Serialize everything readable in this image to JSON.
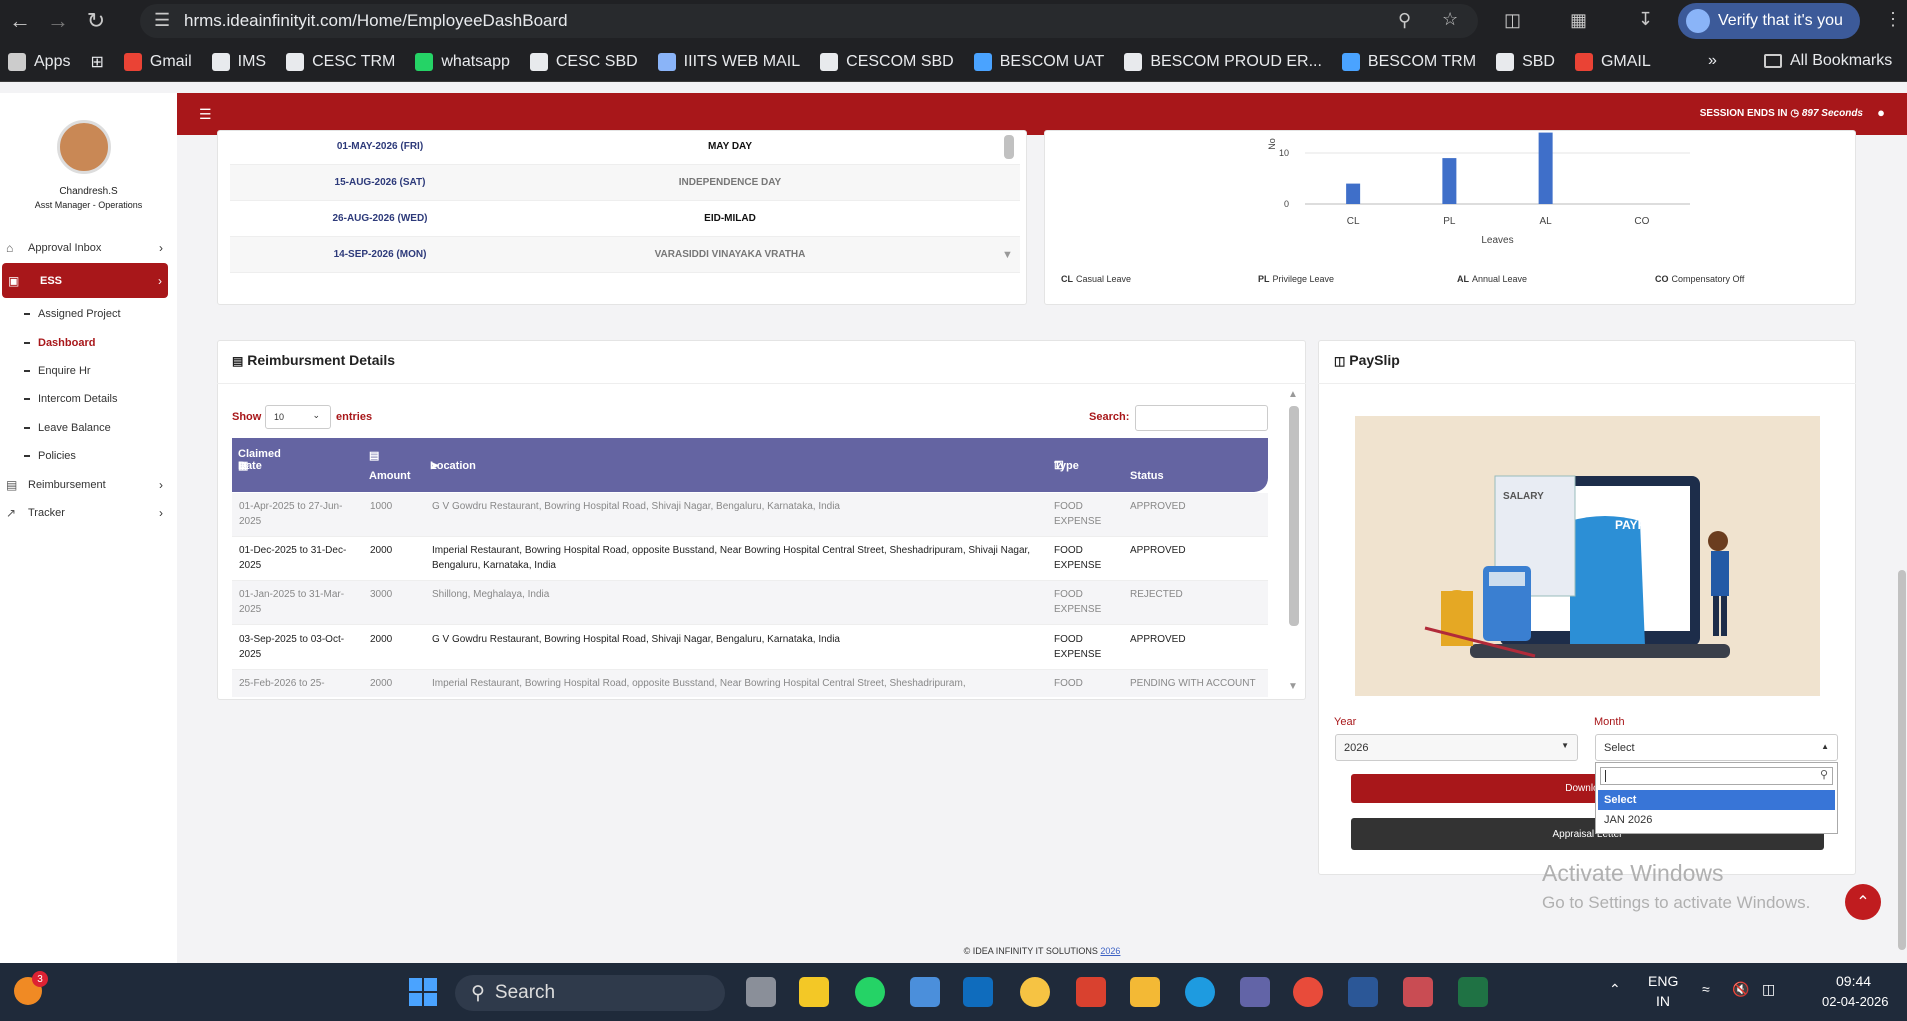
{
  "browser": {
    "url": "hrms.ideainfinityit.com/Home/EmployeeDashBoard",
    "verify_label": "Verify that it's you"
  },
  "bookmarks": {
    "items": [
      "Apps",
      "Gmail",
      "IMS",
      "CESC TRM",
      "whatsapp",
      "CESC SBD",
      "IIITS WEB MAIL",
      "CESCOM SBD",
      "BESCOM UAT",
      "BESCOM PROUD ER...",
      "BESCOM TRM",
      "SBD",
      "GMAIL"
    ],
    "all_label": "All Bookmarks"
  },
  "user": {
    "name": "Chandresh.S",
    "role": "Asst Manager - Operations"
  },
  "sidebar": {
    "items": [
      {
        "label": "Approval Inbox"
      },
      {
        "label": "ESS"
      },
      {
        "label": "Reimbursement"
      },
      {
        "label": "Tracker"
      }
    ],
    "subitems": [
      "Assigned Project",
      "Dashboard",
      "Enquire Hr",
      "Intercom Details",
      "Leave Balance",
      "Policies"
    ]
  },
  "header": {
    "session_label": "SESSION ENDS IN",
    "session_value": "897 Seconds"
  },
  "holidays": [
    {
      "date": "01-MAY-2026 (FRI)",
      "name": "MAY DAY"
    },
    {
      "date": "15-AUG-2026 (SAT)",
      "name": "INDEPENDENCE DAY"
    },
    {
      "date": "26-AUG-2026 (WED)",
      "name": "EID-MILAD"
    },
    {
      "date": "14-SEP-2026 (MON)",
      "name": "VARASIDDI VINAYAKA VRATHA"
    }
  ],
  "chart_data": {
    "type": "bar",
    "categories": [
      "CL",
      "PL",
      "AL",
      "CO"
    ],
    "values": [
      4,
      9,
      14,
      0
    ],
    "xlabel": "Leaves",
    "ylabel": "No",
    "yticks": [
      "0",
      "10"
    ],
    "ylim": [
      0,
      14
    ]
  },
  "leave_legend": [
    {
      "code": "CL",
      "name": "Casual Leave"
    },
    {
      "code": "PL",
      "name": "Privilege Leave"
    },
    {
      "code": "AL",
      "name": "Annual Leave"
    },
    {
      "code": "CO",
      "name": "Compensatory Off"
    }
  ],
  "reimbursement": {
    "title": "Reimbursment Details",
    "show_label": "Show",
    "entries_value": "10",
    "entries_label": "entries",
    "search_label": "Search:",
    "columns": [
      "Claimed Date",
      "Amount",
      "Location",
      "Type",
      "Status"
    ],
    "rows": [
      {
        "date": "01-Apr-2025 to 27-Jun-2025",
        "amount": "1000",
        "location": "G V Gowdru Restaurant, Bowring Hospital Road, Shivaji Nagar, Bengaluru, Karnataka, India",
        "type": "FOOD EXPENSE",
        "status": "APPROVED"
      },
      {
        "date": "01-Dec-2025 to 31-Dec-2025",
        "amount": "2000",
        "location": "Imperial Restaurant, Bowring Hospital Road, opposite Busstand, Near Bowring Hospital Central Street, Sheshadripuram, Shivaji Nagar, Bengaluru, Karnataka, India",
        "type": "FOOD EXPENSE",
        "status": "APPROVED"
      },
      {
        "date": "01-Jan-2025 to 31-Mar-2025",
        "amount": "3000",
        "location": "Shillong, Meghalaya, India",
        "type": "FOOD EXPENSE",
        "status": "REJECTED"
      },
      {
        "date": "03-Sep-2025 to 03-Oct-2025",
        "amount": "2000",
        "location": "G V Gowdru Restaurant, Bowring Hospital Road, Shivaji Nagar, Bengaluru, Karnataka, India",
        "type": "FOOD EXPENSE",
        "status": "APPROVED"
      },
      {
        "date": "25-Feb-2026 to 25-",
        "amount": "2000",
        "location": "Imperial Restaurant, Bowring Hospital Road, opposite Busstand, Near Bowring Hospital Central Street, Sheshadripuram,",
        "type": "FOOD",
        "status": "PENDING WITH ACCOUNT"
      }
    ]
  },
  "payslip": {
    "title": "PaySlip",
    "year_label": "Year",
    "year_value": "2026",
    "month_label": "Month",
    "month_value": "Select",
    "download_label": "Download",
    "appraisal_label": "Appraisal Letter",
    "image_salary": "SALARY",
    "image_payroll": "PAYROLL",
    "month_options": [
      "Select",
      "JAN 2026"
    ]
  },
  "watermark": {
    "line1": "Activate Windows",
    "line2": "Go to Settings to activate Windows."
  },
  "footer": {
    "text": "© IDEA INFINITY IT SOLUTIONS",
    "year": "2026"
  },
  "taskbar": {
    "search": "Search",
    "lang1": "ENG",
    "lang2": "IN",
    "time": "09:44",
    "date": "02-04-2026",
    "badge": "3"
  },
  "colors": {
    "brand": "#a8171a",
    "table_header": "#6464a2",
    "bar": "#3f6fc9"
  }
}
